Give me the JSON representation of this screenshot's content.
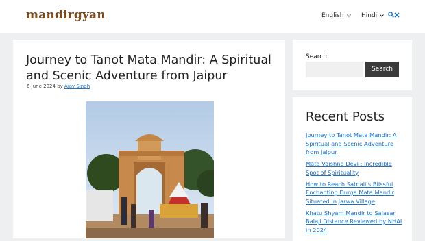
{
  "site": {
    "logo": "mandirgyan"
  },
  "nav": {
    "english": "English",
    "hindi": "Hindi",
    "search_icon": "search-icon",
    "close_icon": "close-icon"
  },
  "post": {
    "title": "Journey to Tanot Mata Mandir: A Spiritual and Scenic Adventure from Jaipur",
    "date": "6 June 2024",
    "by": "by",
    "author": "Ajay Singh"
  },
  "sidebar": {
    "search_label": "Search",
    "search_button": "Search",
    "recent_title": "Recent Posts",
    "recent_posts": [
      "Journey to Tanot Mata Mandir: A Spiritual and Scenic Adventure from Jaipur",
      "Mata Vaishno Devi : Incredible Spot of Spirituality",
      "How to Reach Satnali’s Blissful Enchanting Durga Mata Mandir Situated in Jarwa Village",
      "Khatu Shyam Mandir to Salasar Balaji Distance Reviewed by NHAI in 2024"
    ]
  },
  "colors": {
    "accent": "#1e73be",
    "logo": "#7a4b1e",
    "button": "#3a3a3a"
  }
}
